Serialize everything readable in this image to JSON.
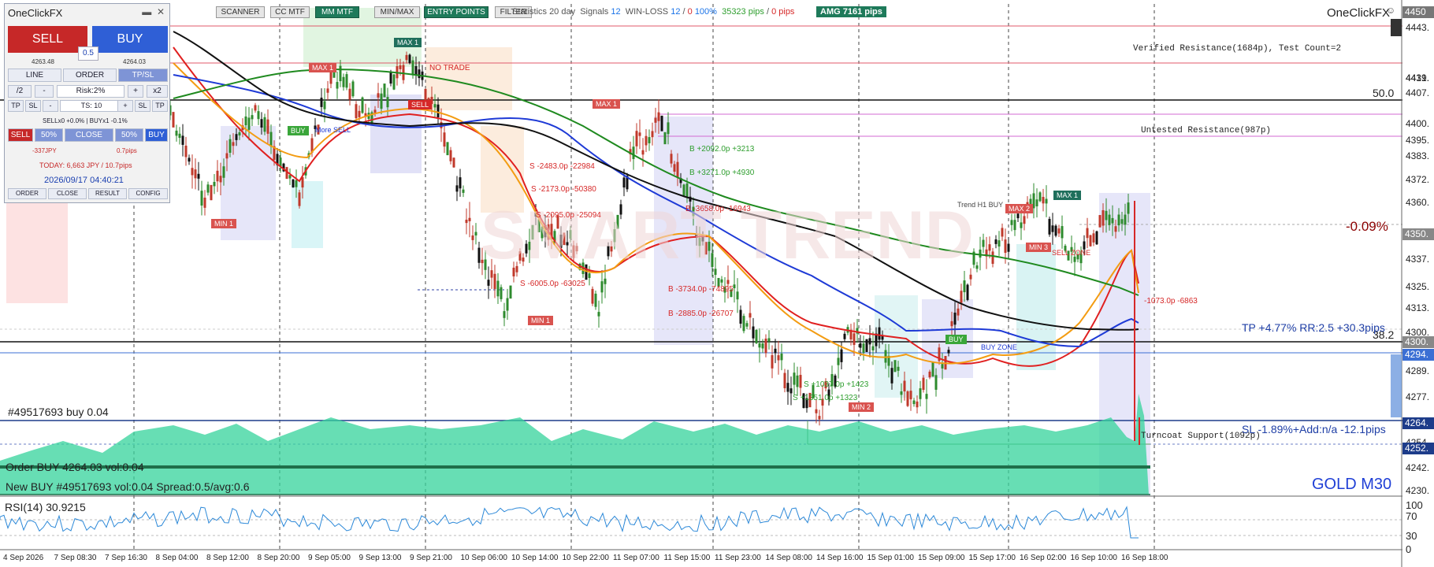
{
  "colors": {
    "sell": "#c62828",
    "buy": "#2f5fd6",
    "ema_red": "#e02020",
    "ema_orange": "#f39c12",
    "ema_blue": "#1e3ad6",
    "ema_green": "#1f8a1f",
    "ema_black": "#111111",
    "volume": "#34d39b",
    "rsi": "#2b88d8"
  },
  "toolbar": {
    "buttons": [
      "SCANNER",
      "CC MTF",
      "MM MTF",
      "MIN/MAX",
      "ENTRY POINTS",
      "FILTER"
    ],
    "stats_label": "Statistics 20 day",
    "signals_label": "Signals",
    "signals_value": "12",
    "winloss_label": "WIN-LOSS",
    "win": "12",
    "loss": "0",
    "winrate": "100%",
    "pips_win": "35323 pips",
    "pips_loss": "0 pips",
    "amg": "AMG   7161 pips"
  },
  "brand": "OneClickFX",
  "panel": {
    "title": "OneClickFX",
    "sell_label": "SELL",
    "buy_label": "BUY",
    "sell_price": "4263.48",
    "buy_price": "4264.03",
    "spread": "0.5",
    "tabs": [
      "LINE",
      "ORDER",
      "TP/SL"
    ],
    "lot_div": "/2",
    "lot_minus": "-",
    "risk": "Risk:2%",
    "lot_plus": "+",
    "lot_mul": "x2",
    "row3": [
      "TP",
      "SL",
      "-",
      "TS: 10",
      "+",
      "SL",
      "TP"
    ],
    "positions": "SELLx0 +0.0%  |  BUYx1 -0.1%",
    "sell_btn": "SELL",
    "pct_left": "50%",
    "close": "CLOSE",
    "pct_right": "50%",
    "buy_btn": "BUY",
    "pl_jpy": "-337JPY",
    "pl_pips": "0.7pips",
    "today": "TODAY: 6,663 JPY / 10.7pips",
    "datetime": "2026/09/17   04:40:21",
    "footer": [
      "ORDER",
      "CLOSE",
      "RESULT",
      "CONFIG"
    ]
  },
  "price_axis": {
    "ticks": [
      "4450",
      "4443.",
      "4431.",
      "4419.",
      "4407.",
      "4400.",
      "4395.",
      "4383.",
      "4372.",
      "4360.",
      "4350.",
      "4337.",
      "4325.",
      "4313.",
      "4300.",
      "4294.",
      "4289.",
      "4277.",
      "4264.",
      "4254.",
      "4252.",
      "4242.",
      "4230."
    ],
    "tags": [
      {
        "text": "4450",
        "color": "#777777"
      },
      {
        "text": "4350.",
        "color": "#888888"
      },
      {
        "text": "4300.",
        "color": "#888888"
      },
      {
        "text": "4294.",
        "color": "#3b6fd4"
      },
      {
        "text": "4264.",
        "color": "#1d3c8a"
      },
      {
        "text": "4252.",
        "color": "#1d3c8a"
      }
    ]
  },
  "rsi_axis": {
    "ticks": [
      "100",
      "70",
      "30",
      "0"
    ]
  },
  "time_axis": [
    "4 Sep 2026",
    "7 Sep 08:30",
    "7 Sep 16:30",
    "8 Sep 04:00",
    "8 Sep 12:00",
    "8 Sep 20:00",
    "9 Sep 05:00",
    "9 Sep 13:00",
    "9 Sep 21:00",
    "10 Sep 06:00",
    "10 Sep 14:00",
    "10 Sep 22:00",
    "11 Sep 07:00",
    "11 Sep 15:00",
    "11 Sep 23:00",
    "14 Sep 08:00",
    "14 Sep 16:00",
    "15 Sep 01:00",
    "15 Sep 09:00",
    "15 Sep 17:00",
    "16 Sep 02:00",
    "16 Sep 10:00",
    "16 Sep 18:00"
  ],
  "levels": {
    "verified_res": "Verified Resistance(1684p), Test Count=2",
    "untested_res": "Untested Resistance(987p)",
    "turncoat": "Turncoat Support(1092p)",
    "fib_500": "50.0",
    "fib_382": "38.2",
    "tp": "TP +4.77% RR:2.5 +30.3pips",
    "sl": "SL -1.89%+Add:n/a -12.1pips",
    "pct_change": "-0.09%",
    "order_label": "#49517693 buy 0.04",
    "order_text": "Order BUY 4264.03 vol:0.04",
    "new_text": "New BUY #49517693 vol:0.04 Spread:0.5/avg:0.6",
    "symbol": "GOLD M30",
    "rsi_label": "RSI(14) 30.9215",
    "watermark": "SMART TREND"
  },
  "chart_tags": [
    {
      "text": "MAX 1",
      "color": "#1f6f5c"
    },
    {
      "text": "MAX 1",
      "color": "#d9534f"
    },
    {
      "text": "MAX 1",
      "color": "#d9534f"
    },
    {
      "text": "MAX 1",
      "color": "#1f6f5c"
    },
    {
      "text": "MAX 2",
      "color": "#d9534f"
    },
    {
      "text": "MIN 1",
      "color": "#d9534f"
    },
    {
      "text": "MIN 1",
      "color": "#d9534f"
    },
    {
      "text": "MIN 2",
      "color": "#d9534f"
    },
    {
      "text": "MIN 3",
      "color": "#d9534f"
    },
    {
      "text": "SELL",
      "color": "#d62828"
    },
    {
      "text": "BUY",
      "color": "#3aa63a"
    },
    {
      "text": "BUY",
      "color": "#3aa63a"
    }
  ],
  "annotations": [
    "NO TRADE",
    "Trend H1 BUY",
    "SELL ZONE",
    "BUY ZONE",
    "More SELL",
    "S -2483.0p -22984",
    "S -2173.0p -50380",
    "S -2095.0p -25094",
    "S -6005.0p -63025",
    "B -3734.0p -74895",
    "B -2885.0p -26707",
    "B +2092.0p +3213",
    "B +3271.0p +4930",
    "B -3658.0p -16943",
    "-1073.0p -6863",
    "S +1037.0p +1423",
    "S +1351.0p +1323"
  ]
}
